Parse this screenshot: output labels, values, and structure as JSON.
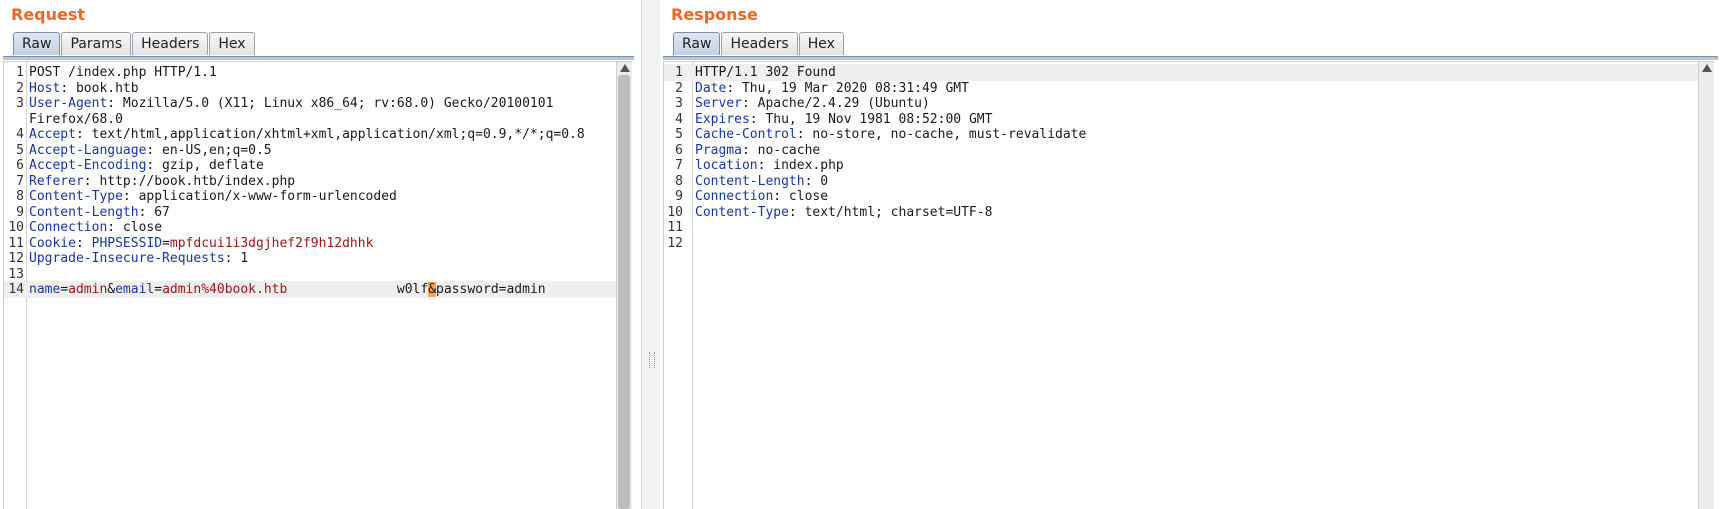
{
  "request": {
    "title": "Request",
    "tabs": [
      "Raw",
      "Params",
      "Headers",
      "Hex"
    ],
    "active_tab": "Raw",
    "lines": [
      {
        "n": "1",
        "parts": [
          {
            "t": "POST /index.php HTTP/1.1"
          }
        ]
      },
      {
        "n": "2",
        "parts": [
          {
            "t": "Host",
            "c": "key"
          },
          {
            "t": ": book.htb"
          }
        ]
      },
      {
        "n": "3",
        "parts": [
          {
            "t": "User-Agent",
            "c": "key"
          },
          {
            "t": ": Mozilla/5.0 (X11; Linux x86_64; rv:68.0) Gecko/20100101"
          }
        ]
      },
      {
        "n": "",
        "parts": [
          {
            "t": "Firefox/68.0"
          }
        ]
      },
      {
        "n": "4",
        "parts": [
          {
            "t": "Accept",
            "c": "key"
          },
          {
            "t": ": text/html,application/xhtml+xml,application/xml;q=0.9,*/*;q=0.8"
          }
        ]
      },
      {
        "n": "5",
        "parts": [
          {
            "t": "Accept-Language",
            "c": "key"
          },
          {
            "t": ": en-US,en;q=0.5"
          }
        ]
      },
      {
        "n": "6",
        "parts": [
          {
            "t": "Accept-Encoding",
            "c": "key"
          },
          {
            "t": ": gzip, deflate"
          }
        ]
      },
      {
        "n": "7",
        "parts": [
          {
            "t": "Referer",
            "c": "key"
          },
          {
            "t": ": http://book.htb/index.php"
          }
        ]
      },
      {
        "n": "8",
        "parts": [
          {
            "t": "Content-Type",
            "c": "key"
          },
          {
            "t": ": application/x-www-form-urlencoded"
          }
        ]
      },
      {
        "n": "9",
        "parts": [
          {
            "t": "Content-Length",
            "c": "key"
          },
          {
            "t": ": 67"
          }
        ]
      },
      {
        "n": "10",
        "parts": [
          {
            "t": "Connection",
            "c": "key"
          },
          {
            "t": ": close"
          }
        ]
      },
      {
        "n": "11",
        "parts": [
          {
            "t": "Cookie",
            "c": "key"
          },
          {
            "t": ": "
          },
          {
            "t": "PHPSESSID",
            "c": "key"
          },
          {
            "t": "="
          },
          {
            "t": "mpfdcui1i3dgjhef2f9h12dhhk",
            "c": "val"
          }
        ]
      },
      {
        "n": "12",
        "parts": [
          {
            "t": "Upgrade-Insecure-Requests",
            "c": "key"
          },
          {
            "t": ": 1"
          }
        ]
      },
      {
        "n": "13",
        "parts": []
      },
      {
        "n": "14",
        "hl": true,
        "parts": [
          {
            "t": "name",
            "c": "key"
          },
          {
            "t": "="
          },
          {
            "t": "admin",
            "c": "val"
          },
          {
            "t": "&"
          },
          {
            "t": "email",
            "c": "key"
          },
          {
            "t": "="
          },
          {
            "t": "admin%40book.htb",
            "c": "val"
          },
          {
            "t": "              w0lf"
          },
          {
            "t": "&",
            "c": "caret-mark"
          },
          {
            "t": "password=admin"
          }
        ]
      }
    ]
  },
  "response": {
    "title": "Response",
    "tabs": [
      "Raw",
      "Headers",
      "Hex"
    ],
    "active_tab": "Raw",
    "lines": [
      {
        "n": "1",
        "hl": true,
        "parts": [
          {
            "t": "HTTP/1.1 302 Found"
          }
        ]
      },
      {
        "n": "2",
        "parts": [
          {
            "t": "Date",
            "c": "key"
          },
          {
            "t": ": Thu, 19 Mar 2020 08:31:49 GMT"
          }
        ]
      },
      {
        "n": "3",
        "parts": [
          {
            "t": "Server",
            "c": "key"
          },
          {
            "t": ": Apache/2.4.29 (Ubuntu)"
          }
        ]
      },
      {
        "n": "4",
        "parts": [
          {
            "t": "Expires",
            "c": "key"
          },
          {
            "t": ": Thu, 19 Nov 1981 08:52:00 GMT"
          }
        ]
      },
      {
        "n": "5",
        "parts": [
          {
            "t": "Cache-Control",
            "c": "key"
          },
          {
            "t": ": no-store, no-cache, must-revalidate"
          }
        ]
      },
      {
        "n": "6",
        "parts": [
          {
            "t": "Pragma",
            "c": "key"
          },
          {
            "t": ": no-cache"
          }
        ]
      },
      {
        "n": "7",
        "parts": [
          {
            "t": "location",
            "c": "key"
          },
          {
            "t": ": index.php"
          }
        ]
      },
      {
        "n": "8",
        "parts": [
          {
            "t": "Content-Length",
            "c": "key"
          },
          {
            "t": ": 0"
          }
        ]
      },
      {
        "n": "9",
        "parts": [
          {
            "t": "Connection",
            "c": "key"
          },
          {
            "t": ": close"
          }
        ]
      },
      {
        "n": "10",
        "parts": [
          {
            "t": "Content-Type",
            "c": "key"
          },
          {
            "t": ": text/html; charset=UTF-8"
          }
        ]
      },
      {
        "n": "11",
        "parts": []
      },
      {
        "n": "12",
        "parts": []
      }
    ]
  },
  "colors": {
    "title": "#f26522",
    "header_name": "#1836a8",
    "param_value": "#a31515",
    "caret_highlight": "#f5a25a"
  }
}
